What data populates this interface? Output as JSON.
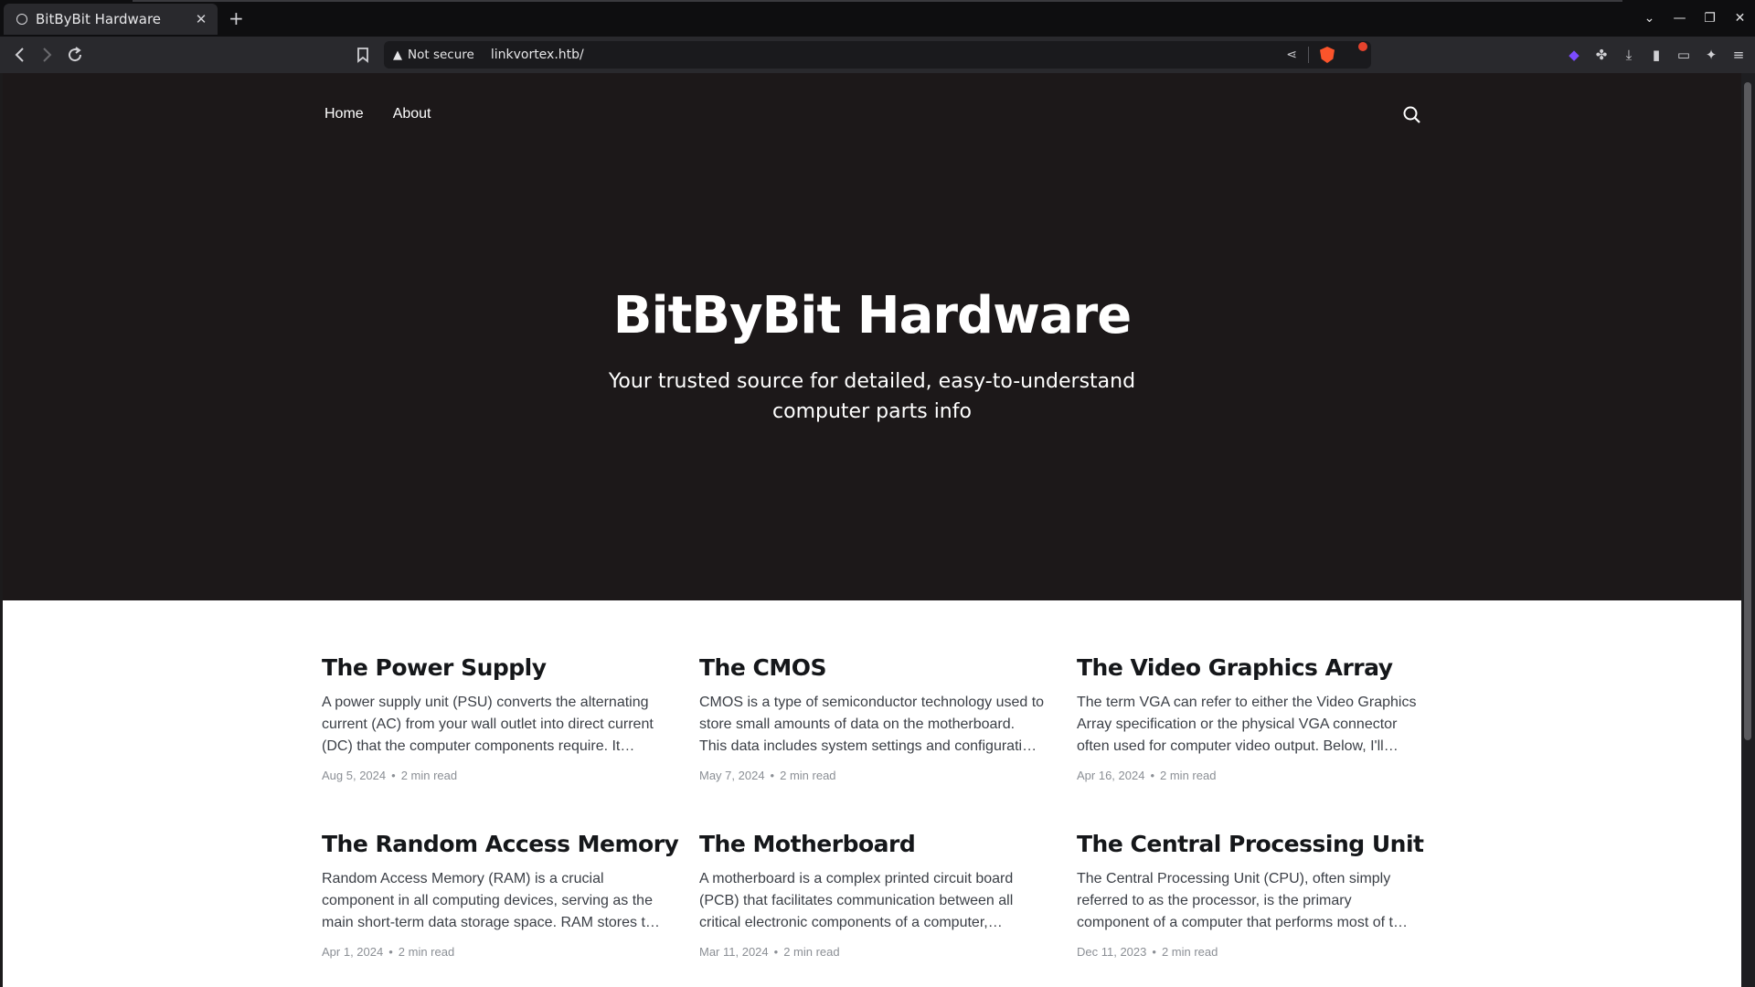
{
  "browser": {
    "tab_title": "BitByBit Hardware",
    "security_label": "Not secure",
    "url": "linkvortex.htb/"
  },
  "site": {
    "nav": [
      "Home",
      "About"
    ],
    "title": "BitByBit Hardware",
    "subtitle": "Your trusted source for detailed, easy-to-understand computer parts info"
  },
  "posts": [
    {
      "title": "The Power Supply",
      "excerpt": "A power supply unit (PSU) converts the alternating current (AC) from your wall outlet into direct current (DC) that the computer components require. It…",
      "date": "Aug 5, 2024",
      "read": "2 min read"
    },
    {
      "title": "The CMOS",
      "excerpt": "CMOS is a type of semiconductor technology used to store small amounts of data on the motherboard. This data includes system settings and configurati…",
      "date": "May 7, 2024",
      "read": "2 min read"
    },
    {
      "title": "The Video Graphics Array",
      "excerpt": "The term VGA can refer to either the Video Graphics Array specification or the physical VGA connector often used for computer video output. Below, I'll…",
      "date": "Apr 16, 2024",
      "read": "2 min read"
    },
    {
      "title": "The Random Access Memory",
      "excerpt": "Random Access Memory (RAM) is a crucial component in all computing devices, serving as the main short-term data storage space. RAM stores t…",
      "date": "Apr 1, 2024",
      "read": "2 min read"
    },
    {
      "title": "The Motherboard",
      "excerpt": "A motherboard is a complex printed circuit board (PCB) that facilitates communication between all critical electronic components of a computer,…",
      "date": "Mar 11, 2024",
      "read": "2 min read"
    },
    {
      "title": "The Central Processing Unit",
      "excerpt": "The Central Processing Unit (CPU), often simply referred to as the processor, is the primary component of a computer that performs most of t…",
      "date": "Dec 11, 2023",
      "read": "2 min read"
    }
  ],
  "colors": {
    "hero_bg": "#1c1819",
    "content_bg": "#ffffff",
    "title_text": "#15171a",
    "meta_text": "#8b8f95"
  }
}
